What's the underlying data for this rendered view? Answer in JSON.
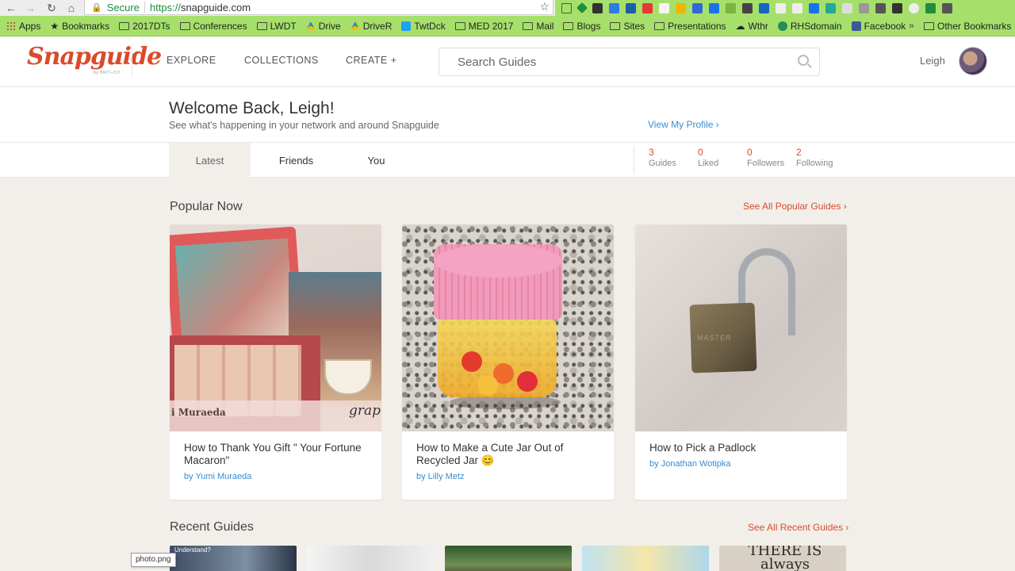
{
  "browser": {
    "secure_label": "Secure",
    "url_scheme": "https://",
    "url_host": "snapguide.com",
    "bookmarks": [
      {
        "label": "Apps",
        "icon": "apps-icon"
      },
      {
        "label": "Bookmarks",
        "icon": "star-icon"
      },
      {
        "label": "2017DTs",
        "icon": "folder-icon"
      },
      {
        "label": "Conferences",
        "icon": "folder-icon"
      },
      {
        "label": "LWDT",
        "icon": "folder-icon"
      },
      {
        "label": "Drive",
        "icon": "drive-icon"
      },
      {
        "label": "DriveR",
        "icon": "drive-icon"
      },
      {
        "label": "TwtDck",
        "icon": "twitter-icon"
      },
      {
        "label": "MED 2017",
        "icon": "folder-icon"
      },
      {
        "label": "Mail",
        "icon": "folder-icon"
      },
      {
        "label": "Blogs",
        "icon": "folder-icon"
      },
      {
        "label": "Sites",
        "icon": "folder-icon"
      },
      {
        "label": "Presentations",
        "icon": "folder-icon"
      },
      {
        "label": "Wthr",
        "icon": "cloud-icon"
      },
      {
        "label": "RHSdomain",
        "icon": "globe-icon"
      },
      {
        "label": "Facebook",
        "icon": "facebook-icon"
      }
    ],
    "more_label": "»",
    "other_bookmarks": "Other Bookmarks",
    "tooltip": "photo.png"
  },
  "header": {
    "logo": "Snapguide",
    "logo_sub": "by BRIT+CO",
    "nav": [
      "EXPLORE",
      "COLLECTIONS",
      "CREATE +"
    ],
    "search_placeholder": "Search Guides",
    "user_name": "Leigh"
  },
  "welcome": {
    "title": "Welcome Back, Leigh!",
    "subtitle": "See what's happening in your network and around Snapguide",
    "profile_link": "View My Profile ›"
  },
  "tabs": [
    "Latest",
    "Friends",
    "You"
  ],
  "stats": [
    {
      "value": "3",
      "label": "Guides"
    },
    {
      "value": "0",
      "label": "Liked"
    },
    {
      "value": "0",
      "label": "Followers"
    },
    {
      "value": "2",
      "label": "Following"
    }
  ],
  "popular": {
    "title": "Popular Now",
    "see_all": "See All Popular Guides ›",
    "cards": [
      {
        "title": "How to Thank You Gift \" Your Fortune Macaron\"",
        "author": "by Yumi Muraeda",
        "watermark_left": "i Muraeda",
        "watermark_right": "graph"
      },
      {
        "title": "How to Make a Cute Jar Out of Recycled Jar 😊",
        "author": "by Lilly Metz"
      },
      {
        "title": "How to Pick a Padlock",
        "author": "by Jonathan Wotipka",
        "lock_brand": "MASTER"
      }
    ]
  },
  "recent": {
    "title": "Recent Guides",
    "see_all": "See All Recent Guides ›",
    "thumb_texts": [
      "Understand?",
      "",
      "",
      "",
      "THERE IS always"
    ]
  },
  "colors": {
    "brand": "#d94b2b",
    "link": "#3b8bd0",
    "bookmark_bar": "#a6e06a",
    "page_bg": "#f2efea"
  }
}
